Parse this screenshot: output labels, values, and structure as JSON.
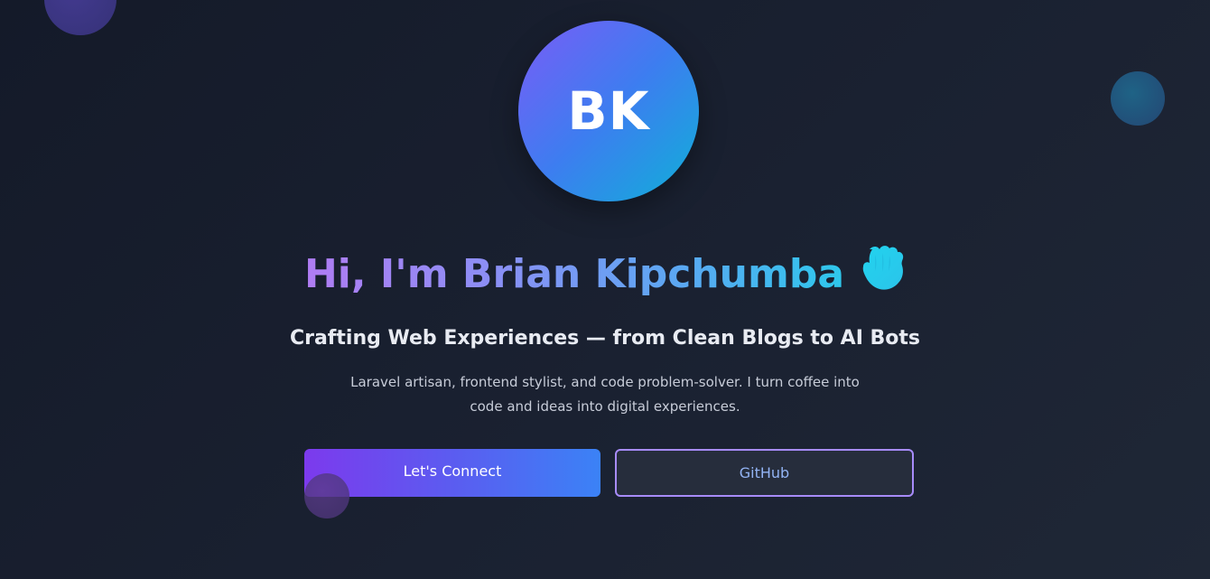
{
  "avatar": {
    "initials": "BK"
  },
  "hero": {
    "headline": "Hi, I'm Brian Kipchumba",
    "headline_icon": "waving-hand-icon",
    "tagline": "Crafting Web Experiences — from Clean Blogs to AI Bots",
    "bio": "Laravel artisan, frontend stylist, and code problem-solver. I turn coffee into code and ideas into digital experiences."
  },
  "actions": {
    "connect_label": "Let's Connect",
    "github_label": "GitHub"
  },
  "colors": {
    "background": "#161c2b",
    "accent_purple": "#7c3aed",
    "accent_blue": "#3b82f6",
    "accent_cyan": "#22d3ee",
    "outline_purple": "#a78bfa"
  }
}
